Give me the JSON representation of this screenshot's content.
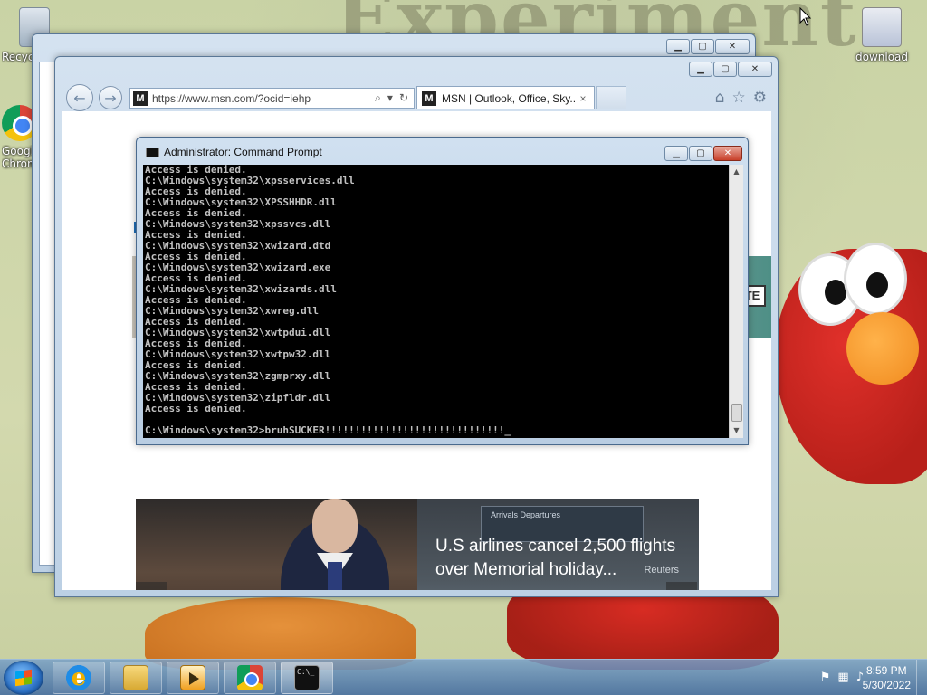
{
  "desktop": {
    "wallpaper_text": "Experiment",
    "icons": [
      {
        "label": "Recycle Bin",
        "icon": "recycle-bin-icon"
      },
      {
        "label": "Google Chrome",
        "icon": "chrome-icon"
      },
      {
        "label": "download",
        "icon": "image-file-icon"
      }
    ]
  },
  "back_window": {
    "buttons": [
      "minimize",
      "maximize",
      "close"
    ]
  },
  "ie": {
    "address": "https://www.msn.com/?ocid=iehp",
    "tab_title": "MSN | Outlook, Office, Sky...",
    "tab_close": "×",
    "favicon_text": "M",
    "toolbar_icons": [
      "home-icon",
      "star-icon",
      "gear-icon"
    ],
    "content": {
      "strip_badge": "TE",
      "headline": "U.S airlines cancel 2,500 flights over Memorial holiday...",
      "source": "Reuters",
      "sign_text": "Arrivals  Departures",
      "prev": "‹",
      "next": "›"
    }
  },
  "cmd": {
    "title": "Administrator: Command Prompt",
    "lines": [
      "Access is denied.",
      "C:\\Windows\\system32\\xpsservices.dll",
      "Access is denied.",
      "C:\\Windows\\system32\\XPSSHHDR.dll",
      "Access is denied.",
      "C:\\Windows\\system32\\xpssvcs.dll",
      "Access is denied.",
      "C:\\Windows\\system32\\xwizard.dtd",
      "Access is denied.",
      "C:\\Windows\\system32\\xwizard.exe",
      "Access is denied.",
      "C:\\Windows\\system32\\xwizards.dll",
      "Access is denied.",
      "C:\\Windows\\system32\\xwreg.dll",
      "Access is denied.",
      "C:\\Windows\\system32\\xwtpdui.dll",
      "Access is denied.",
      "C:\\Windows\\system32\\xwtpw32.dll",
      "Access is denied.",
      "C:\\Windows\\system32\\zgmprxy.dll",
      "Access is denied.",
      "C:\\Windows\\system32\\zipfldr.dll",
      "Access is denied.",
      "",
      "C:\\Windows\\system32>bruhSUCKER!!!!!!!!!!!!!!!!!!!!!!!!!!!!!!_"
    ]
  },
  "taskbar": {
    "pinned": [
      {
        "name": "internet-explorer",
        "icon": "ie-icon"
      },
      {
        "name": "windows-explorer",
        "icon": "folder-icon"
      },
      {
        "name": "media-player",
        "icon": "media-player-icon"
      },
      {
        "name": "google-chrome",
        "icon": "chrome-icon"
      },
      {
        "name": "command-prompt",
        "icon": "cmd-icon"
      }
    ],
    "cmd_glyph": "C:\\_",
    "time": "8:59 PM",
    "date": "5/30/2022"
  }
}
